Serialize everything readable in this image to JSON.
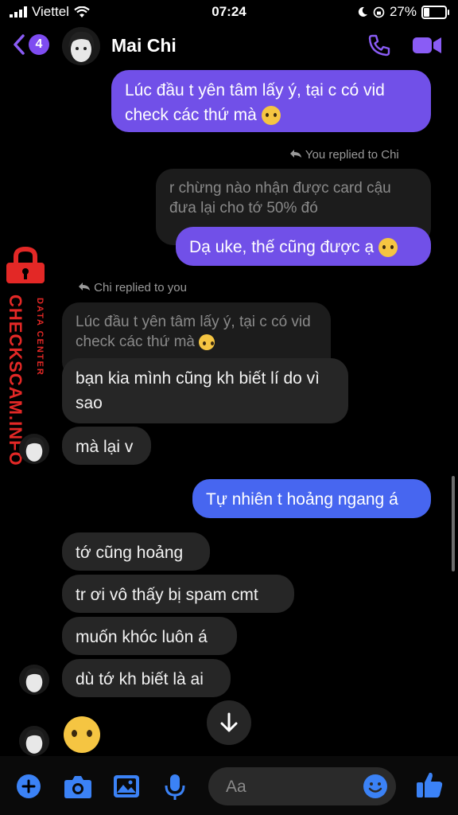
{
  "status_bar": {
    "carrier": "Viettel",
    "time": "07:24",
    "battery": "27%"
  },
  "header": {
    "back_count": "4",
    "contact_name": "Mai Chi"
  },
  "messages": {
    "m1": "Lúc đầu t yên tâm lấy ý, tại c có vid check các thứ mà",
    "reply_note_1": "You replied to Chi",
    "quote_1": "r chừng nào nhận được card cậu đưa lại cho tớ 50% đó",
    "m2": "Dạ uke, thế cũng được ạ",
    "reply_note_2": "Chi replied to you",
    "quote_2": "Lúc đầu t yên tâm lấy ý, tại c có vid check các thứ mà",
    "m3": "bạn kia mình cũng kh biết lí do vì sao",
    "m4": "mà lại v",
    "m5": "Tự nhiên t hoảng ngang á",
    "m6": "tớ cũng hoảng",
    "m7": "tr ơi vô thấy bị spam cmt",
    "m8": "muốn khóc luôn á",
    "m9": "dù tớ kh biết là ai"
  },
  "watermark": {
    "main": "CHECKSCAM.INFO",
    "sub": "DATA CENTER"
  },
  "composer": {
    "placeholder": "Aa"
  },
  "icons": [
    "back-chevron-icon",
    "phone-icon",
    "video-camera-icon",
    "reply-arrow-icon",
    "scroll-down-arrow-icon",
    "plus-icon",
    "camera-icon",
    "image-icon",
    "microphone-icon",
    "emoji-icon",
    "thumbs-up-icon",
    "lock-icon",
    "pleading-face-emoji"
  ],
  "colors": {
    "my_bubble": "#7150e8",
    "my_bubble_recent": "#4766f0",
    "their_bubble": "#262626",
    "accent": "#8a5cf5",
    "watermark_red": "#e32826"
  }
}
